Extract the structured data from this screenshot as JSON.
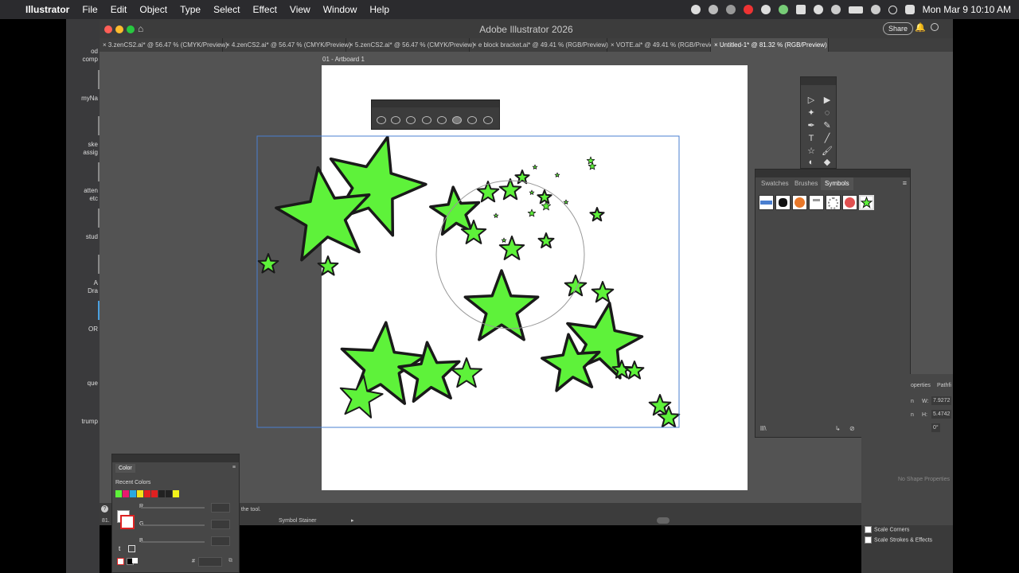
{
  "menubar": {
    "app_name": "Illustrator",
    "items": [
      "File",
      "Edit",
      "Object",
      "Type",
      "Select",
      "Effect",
      "View",
      "Window",
      "Help"
    ],
    "clock": "Mon Mar 9  10:10 AM"
  },
  "left_strip": {
    "labels": [
      "od",
      "comp",
      "myNa",
      "ske",
      "assig",
      "atten",
      "etc",
      "stud",
      "A",
      "Dra",
      "OR",
      "que",
      "trump"
    ]
  },
  "window": {
    "title": "Adobe Illustrator 2026",
    "share_label": "Share"
  },
  "tabs": [
    {
      "label": "3.zenCS2.ai* @ 56.47 % (CMYK/Preview)"
    },
    {
      "label": "4.zenCS2.ai* @ 56.47 % (CMYK/Preview)"
    },
    {
      "label": "5.zenCS2.ai* @ 56.47 % (CMYK/Preview)"
    },
    {
      "label": "e block bracket.ai* @ 49.41 % (RGB/Preview)"
    },
    {
      "label": "VOTE.ai* @ 49.41 % (RGB/Preview)"
    },
    {
      "label": "Untitled-1* @ 81.32 % (RGB/Preview)"
    }
  ],
  "artboard": {
    "label": "01 - Artboard 1"
  },
  "symbols_panel": {
    "tabs": [
      "Swatches",
      "Brushes",
      "Symbols"
    ],
    "active_tab": "Symbols"
  },
  "properties": {
    "tab_left": "operties",
    "tab_right": "Pathfi",
    "w_label": "W:",
    "w_value": "7.9272",
    "h_label": "H:",
    "h_value": "5.4742",
    "angle_value": "0°",
    "x_label": "n",
    "y_label": "n",
    "empty_text": "No Shape Properties"
  },
  "checkboxes": {
    "scale_corners": "Scale Corners",
    "scale_strokes": "Scale Strokes & Effects"
  },
  "statusbar": {
    "zoom": "81.",
    "hint": "e the tool.",
    "tool_name": "Symbol Stainer"
  },
  "color_panel": {
    "title": "Color",
    "recent_label": "Recent Colors",
    "r_label": "R",
    "g_label": "G",
    "b_label": "B",
    "hex_label": "#"
  },
  "colors": {
    "star_fill": "#5ef23a",
    "star_stroke": "#1a1a1a",
    "selection": "#4a7fd0",
    "recent": [
      "#5ef23a",
      "#e8186e",
      "#29a8e0",
      "#f2e21a",
      "#e02020",
      "#e02020",
      "#222222",
      "#222222",
      "#f2f21a"
    ]
  },
  "icons": [
    "apple-icon",
    "home-icon",
    "search-icon",
    "bell-icon",
    "wifi-icon",
    "battery-icon",
    "help-icon"
  ]
}
